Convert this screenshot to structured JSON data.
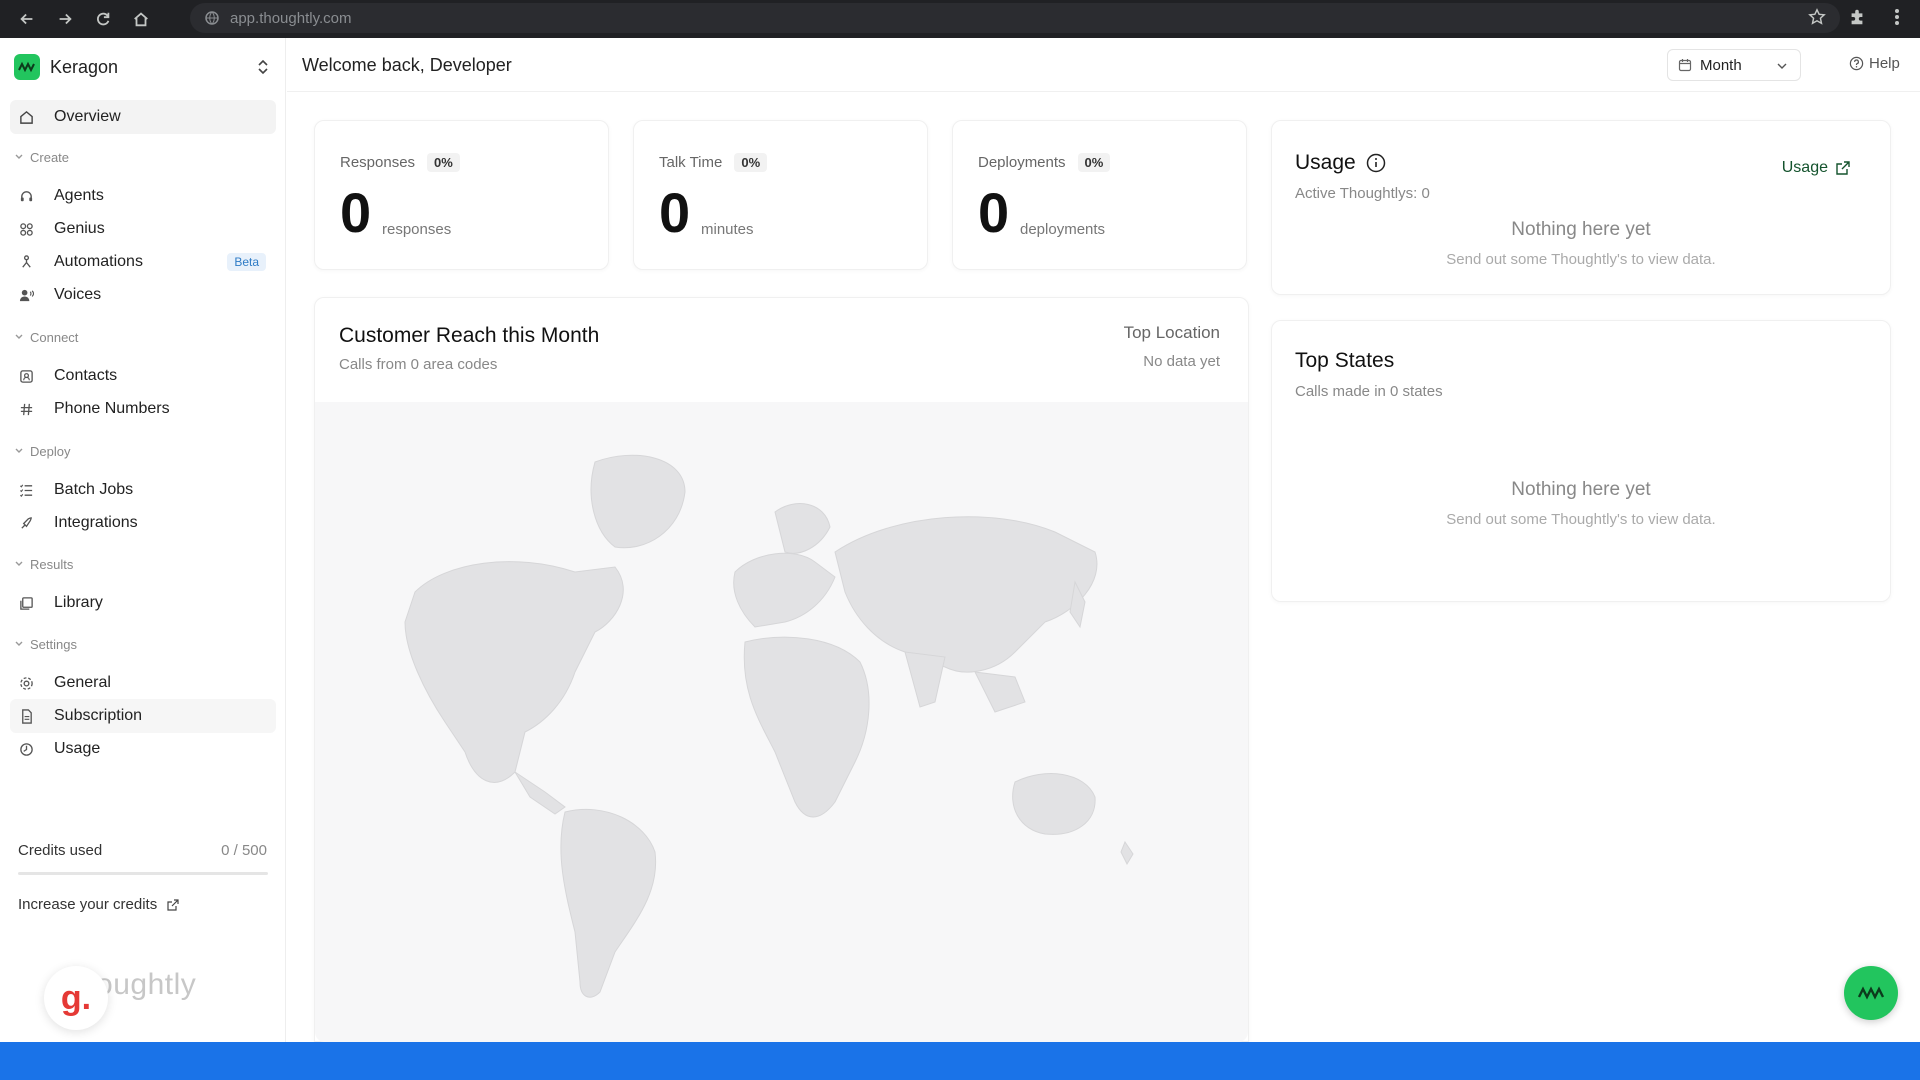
{
  "browser": {
    "url": "app.thoughtly.com"
  },
  "workspace": {
    "name": "Keragon"
  },
  "sidebar": {
    "overview": "Overview",
    "sections": {
      "create": "Create",
      "connect": "Connect",
      "deploy": "Deploy",
      "results": "Results",
      "settings": "Settings"
    },
    "items": {
      "agents": "Agents",
      "genius": "Genius",
      "automations": "Automations",
      "automations_badge": "Beta",
      "voices": "Voices",
      "contacts": "Contacts",
      "phone_numbers": "Phone Numbers",
      "batch_jobs": "Batch Jobs",
      "integrations": "Integrations",
      "library": "Library",
      "general": "General",
      "subscription": "Subscription",
      "usage": "Usage"
    },
    "credits": {
      "label": "Credits used",
      "value": "0 / 500",
      "fraction": 0
    },
    "increase_credits": "Increase your credits",
    "brand_watermark": "thoughtly",
    "g_badge": "g."
  },
  "header": {
    "welcome": "Welcome back, Developer",
    "period": "Month",
    "help": "Help"
  },
  "stats": {
    "responses": {
      "label": "Responses",
      "pct": "0%",
      "value": "0",
      "unit": "responses"
    },
    "talk_time": {
      "label": "Talk Time",
      "pct": "0%",
      "value": "0",
      "unit": "minutes"
    },
    "deployments": {
      "label": "Deployments",
      "pct": "0%",
      "value": "0",
      "unit": "deployments"
    }
  },
  "usage_card": {
    "title": "Usage",
    "link": "Usage",
    "subtitle": "Active Thoughtlys: 0",
    "empty_title": "Nothing here yet",
    "empty_sub": "Send out some Thoughtly's to view data."
  },
  "reach_card": {
    "title": "Customer Reach this Month",
    "subtitle": "Calls from 0 area codes",
    "top_location_label": "Top Location",
    "top_location_value": "No data yet"
  },
  "states_card": {
    "title": "Top States",
    "subtitle": "Calls made in 0 states",
    "empty_title": "Nothing here yet",
    "empty_sub": "Send out some Thoughtly's to view data."
  },
  "colors": {
    "brand": "#22c55e",
    "beta_bg": "#e8f1fb",
    "beta_text": "#2f7cc6",
    "map": "#e2e2e4"
  }
}
